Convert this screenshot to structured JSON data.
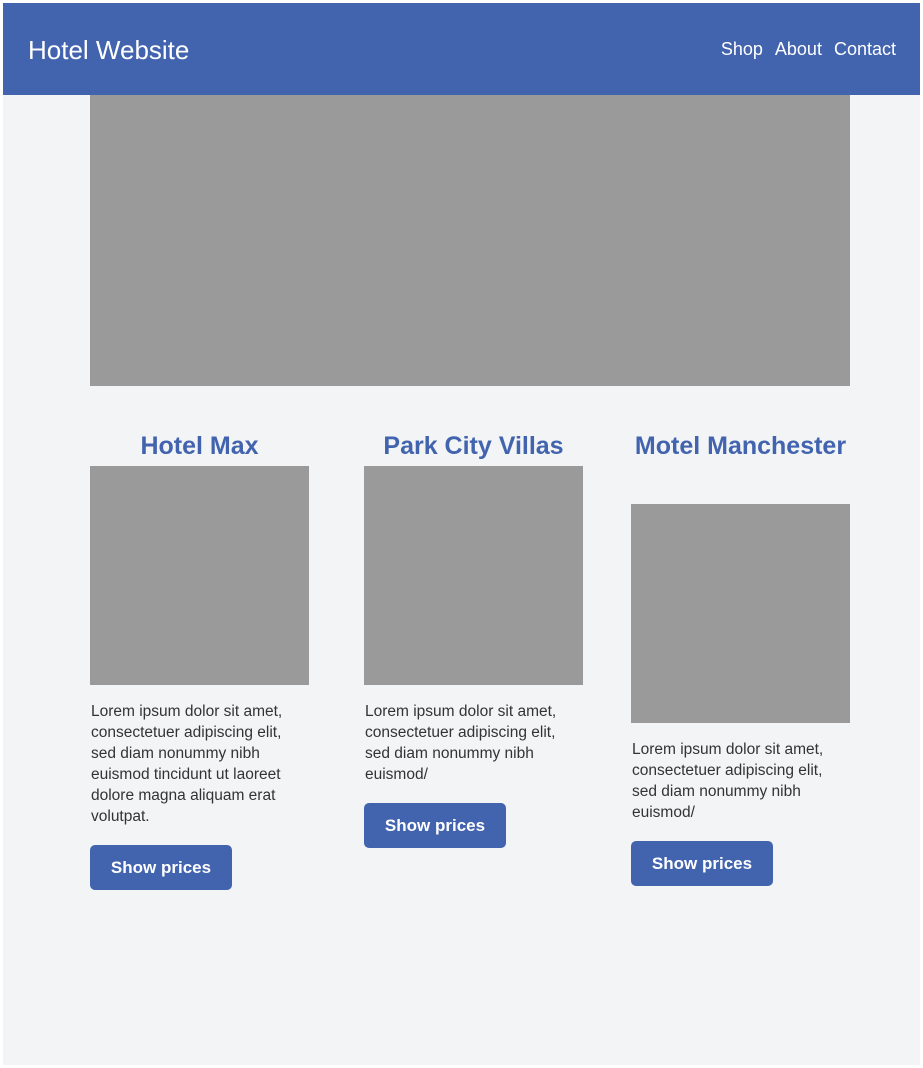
{
  "header": {
    "title": "Hotel Website",
    "nav": [
      {
        "label": "Shop"
      },
      {
        "label": "About"
      },
      {
        "label": "Contact"
      }
    ]
  },
  "hotels": [
    {
      "name": "Hotel Max",
      "description": "Lorem ipsum dolor sit amet, consectetuer adipiscing elit, sed diam nonummy nibh euismod tincidunt ut laoreet dolore magna aliquam erat volutpat.",
      "button_label": "Show prices"
    },
    {
      "name": "Park City Villas",
      "description": "Lorem ipsum dolor sit amet, consectetuer adipiscing elit, sed diam nonummy nibh euismod/",
      "button_label": "Show prices"
    },
    {
      "name": "Motel Manchester",
      "description": "Lorem ipsum dolor sit amet, consectetuer adipiscing elit, sed diam nonummy nibh euismod/",
      "button_label": "Show prices"
    }
  ],
  "colors": {
    "brand": "#4263ae",
    "placeholder": "#999a99",
    "background": "#f3f4f6"
  }
}
